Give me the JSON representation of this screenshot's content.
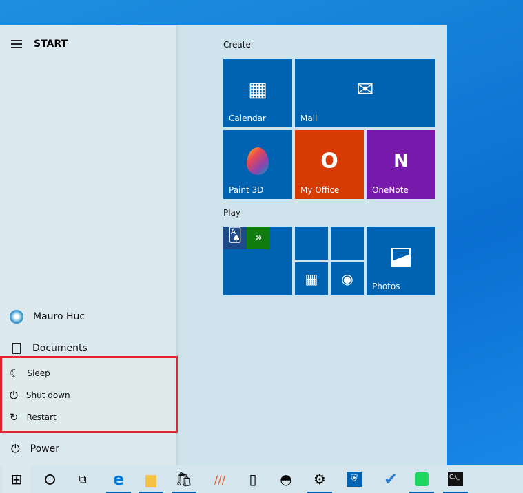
{
  "header": {
    "title": "START"
  },
  "left": {
    "user": "Mauro Huc",
    "documents": "Documents",
    "power_menu": [
      {
        "label": "Sleep",
        "icon": "moon-icon"
      },
      {
        "label": "Shut down",
        "icon": "power-icon"
      },
      {
        "label": "Restart",
        "icon": "restart-icon"
      }
    ],
    "power": "Power"
  },
  "groups": {
    "create": "Create",
    "play": "Play"
  },
  "tiles": {
    "calendar": "Calendar",
    "mail": "Mail",
    "paint3d": "Paint 3D",
    "myoffice": "My Office",
    "onenote": "OneNote",
    "photos": "Photos"
  },
  "colors": {
    "tile_blue": "#0063b1",
    "office": "#d83b01",
    "onenote": "#7719aa",
    "highlight": "#e0262e"
  }
}
